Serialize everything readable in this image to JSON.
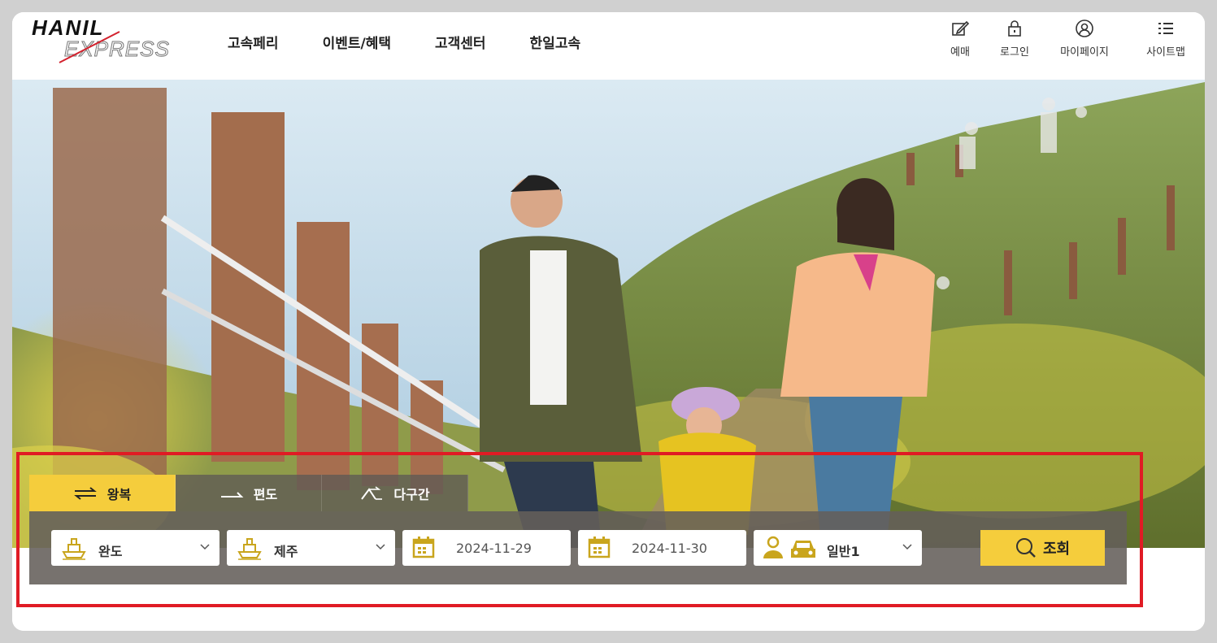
{
  "brand": {
    "logo_line1": "HANIL",
    "logo_line2": "EXPRESS"
  },
  "nav": {
    "items": [
      {
        "label": "고속페리"
      },
      {
        "label": "이벤트/혜택"
      },
      {
        "label": "고객센터"
      },
      {
        "label": "한일고속"
      }
    ]
  },
  "utility": {
    "items": [
      {
        "label": "예매",
        "icon": "edit-icon"
      },
      {
        "label": "로그인",
        "icon": "lock-icon"
      },
      {
        "label": "마이페이지",
        "icon": "user-icon"
      },
      {
        "label": "사이트맵",
        "icon": "list-icon"
      }
    ]
  },
  "booking": {
    "tabs": [
      {
        "label": "왕복",
        "active": true
      },
      {
        "label": "편도",
        "active": false
      },
      {
        "label": "다구간",
        "active": false
      }
    ],
    "departure": "완도",
    "arrival": "제주",
    "depart_date": "2024-11-29",
    "return_date": "2024-11-30",
    "passengers": "일반1",
    "search_label": "조회"
  },
  "colors": {
    "accent": "#f5cd3c",
    "highlight": "#e01b24",
    "panel": "#645f5a"
  }
}
